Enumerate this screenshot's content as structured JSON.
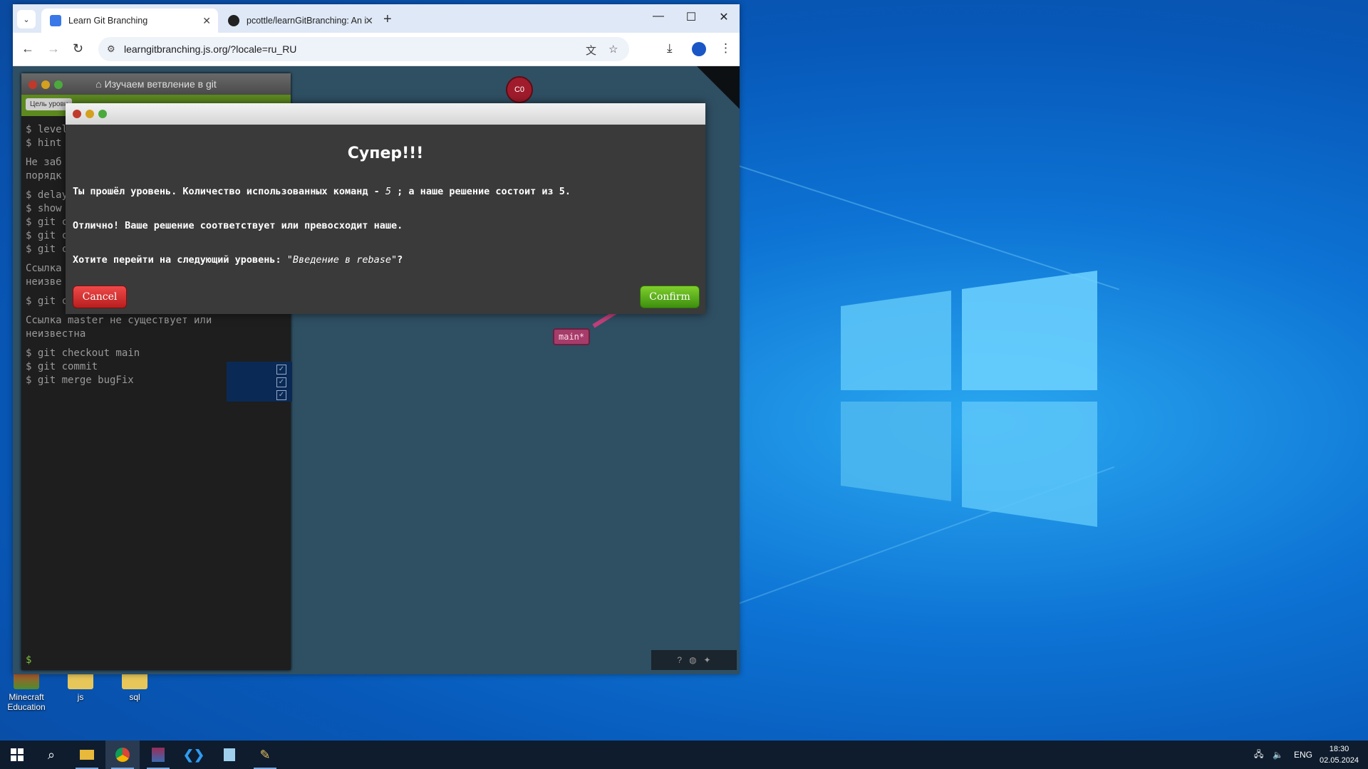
{
  "browser": {
    "tabs": [
      {
        "title": "Learn Git Branching",
        "active": true
      },
      {
        "title": "pcottle/learnGitBranching: An i",
        "active": false
      }
    ],
    "url": "learngitbranching.js.org/?locale=ru_RU"
  },
  "terminal": {
    "title": "Изучаем ветвление в git",
    "goal_button": "Цель уровн",
    "lines": [
      "$ level",
      "$ hint",
      "Не заб",
      "порядк",
      "$ delay",
      "$ show",
      "$ git c",
      "$ git c",
      "$ git c",
      "Ссылка",
      "неизве",
      "$ git c",
      "Ссылка master не существует или",
      "неизвестна",
      "$ git checkout main",
      "$ git commit",
      "$ git merge bugFix"
    ],
    "prompt": "$"
  },
  "viz": {
    "commit_label": "C0",
    "branch_label": "main*"
  },
  "modal": {
    "heading": "Супер!!!",
    "line1_a": "Ты прошёл уровень. Количество использованных команд - ",
    "line1_num": "5",
    "line1_b": " ; а наше решение состоит из 5.",
    "line2": "Отлично! Ваше решение соответствует или превосходит наше.",
    "line3_a": "Хотите перейти на следующий уровень: ",
    "line3_level": "\"Введение в rebase\"",
    "line3_b": "?",
    "cancel": "Cancel",
    "confirm": "Confirm"
  },
  "desktop": {
    "icons": [
      {
        "label": "Minecraft Education"
      },
      {
        "label": "js"
      },
      {
        "label": "sql"
      }
    ]
  },
  "taskbar": {
    "lang": "ENG",
    "time": "18:30",
    "date": "02.05.2024"
  }
}
